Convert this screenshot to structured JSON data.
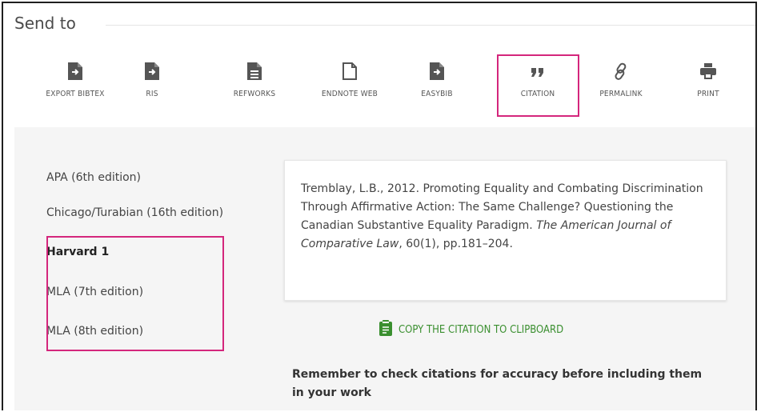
{
  "section": {
    "title": "Send to"
  },
  "toolbar": {
    "items": [
      {
        "label": "EXPORT BIBTEX",
        "icon": "file-export-icon"
      },
      {
        "label": "RIS",
        "icon": "file-export-icon"
      },
      {
        "label": "REFWORKS",
        "icon": "document-icon"
      },
      {
        "label": "ENDNOTE WEB",
        "icon": "document-outline-icon"
      },
      {
        "label": "EASYBIB",
        "icon": "file-export-icon"
      },
      {
        "label": "CITATION",
        "icon": "quote-icon"
      },
      {
        "label": "PERMALINK",
        "icon": "link-icon"
      },
      {
        "label": "PRINT",
        "icon": "printer-icon"
      }
    ],
    "selected": "CITATION"
  },
  "citation_styles": {
    "items": [
      "APA (6th edition)",
      "Chicago/Turabian (16th edition)",
      "Harvard 1",
      "MLA (7th edition)",
      "MLA (8th edition)"
    ],
    "selected": "Harvard 1"
  },
  "citation": {
    "before_journal": "Tremblay, L.B., 2012. Promoting Equality and Combating Discrimination Through Affirmative Action: The Same Challenge? Questioning the Canadian Substantive Equality Paradigm. ",
    "journal": "The American Journal of Comparative Law",
    "after_journal": ", 60(1), pp.181–204."
  },
  "copy_button": {
    "label": "COPY THE CITATION TO CLIPBOARD",
    "icon": "clipboard-icon"
  },
  "reminder": "Remember to check citations for accuracy before including them in your work",
  "colors": {
    "highlight": "#d4267c",
    "copy_green": "#3a8f2f",
    "panel_bg": "#f5f5f5"
  }
}
